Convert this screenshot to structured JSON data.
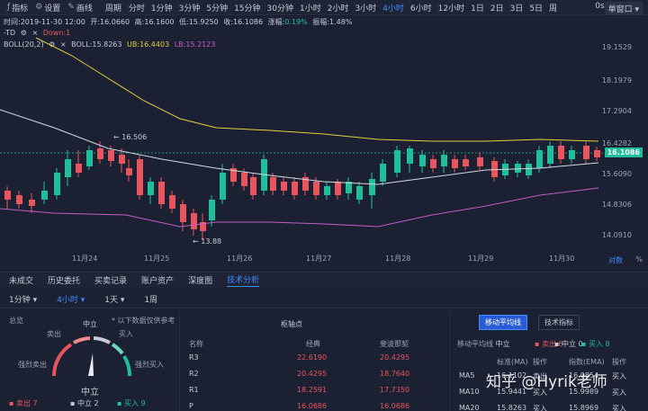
{
  "toolbar": {
    "indicators": "指标",
    "settings": "设置",
    "draw": "画线",
    "period": "周期",
    "periods": [
      "分时",
      "1分钟",
      "3分钟",
      "5分钟",
      "15分钟",
      "30分钟",
      "1小时",
      "2小时",
      "3小时",
      "4小时",
      "6小时",
      "12小时",
      "1日",
      "2日",
      "3日",
      "5日",
      "周"
    ],
    "active_period": "4小时",
    "zero_s": "0s",
    "single_window": "单窗口"
  },
  "info": {
    "time": "时间:2019-11-30 12:00",
    "open": "开:16.0660",
    "high": "高:16.1600",
    "low": "低:15.9250",
    "close": "收:16.1086",
    "change_label": "涨幅:",
    "change": "0.19%",
    "amplitude": "振幅:1.48%",
    "td_label": "-TD",
    "td_down": "Down:1",
    "boll_label": "BOLL(20,2)",
    "boll": "BOLL:15.8263",
    "ub": "UB:16.4403",
    "lb": "LB:15.2123"
  },
  "price_axis": {
    "labels": [
      "19.1529",
      "18.1979",
      "17.2904",
      "16.4282",
      "15.6090",
      "14.8306",
      "14.0910"
    ],
    "current": "16.1086"
  },
  "annotations": {
    "high": "16.506",
    "low": "13.88"
  },
  "date_axis": {
    "labels": [
      "11月24",
      "11月25",
      "11月26",
      "11月27",
      "11月28",
      "11月29",
      "11月30"
    ],
    "log": "对数",
    "pct": "%"
  },
  "bottom_tabs": [
    "未成交",
    "历史委托",
    "买卖记录",
    "账户资产",
    "深度图",
    "技术分析"
  ],
  "active_tab": "技术分析",
  "controls": {
    "c1": "1分钟",
    "c2": "4小时",
    "c3": "1天",
    "c4": "1周"
  },
  "summary": {
    "title": "总览",
    "note": "* 以下数据仅供参考",
    "neutral": "中立",
    "sell": "卖出",
    "buy": "买入",
    "strong_sell": "强烈卖出",
    "strong_buy": "强烈买入",
    "gauge_value": "中立",
    "sell_count": "卖出 7",
    "neutral_count": "中立 2",
    "buy_count": "买入 9"
  },
  "pivot": {
    "title": "枢轴点",
    "col_name": "名称",
    "col_classic": "经典",
    "col_fib": "斐波那契",
    "rows": [
      {
        "name": "R3",
        "classic": "22.6190",
        "fib": "20.4295"
      },
      {
        "name": "R2",
        "classic": "20.4295",
        "fib": "18.7640"
      },
      {
        "name": "R1",
        "classic": "18.2591",
        "fib": "17.7350"
      },
      {
        "name": "P",
        "classic": "16.0686",
        "fib": "16.0686"
      }
    ]
  },
  "ma": {
    "tab_ma": "移动平均线",
    "tab_ti": "技术指标",
    "summary_label": "移动平均线",
    "summary_value": "中立",
    "sell": "卖出 6",
    "neutral": "中立 0",
    "buy": "买入 8",
    "col_name": "",
    "col_ma": "标准(MA)",
    "col_op": "操作",
    "col_ema": "指数(EMA)",
    "col_op2": "操作",
    "rows": [
      {
        "name": "MA5",
        "ma": "16.1102",
        "op": "卖出",
        "ema": "16.0854",
        "op2": "买入"
      },
      {
        "name": "MA10",
        "ma": "15.9441",
        "op": "买入",
        "ema": "15.9989",
        "op2": "买入"
      },
      {
        "name": "MA20",
        "ma": "15.8263",
        "op": "买入",
        "ema": "15.8969",
        "op2": "买入"
      }
    ]
  },
  "watermark": "知乎 @Hyrik老师"
}
